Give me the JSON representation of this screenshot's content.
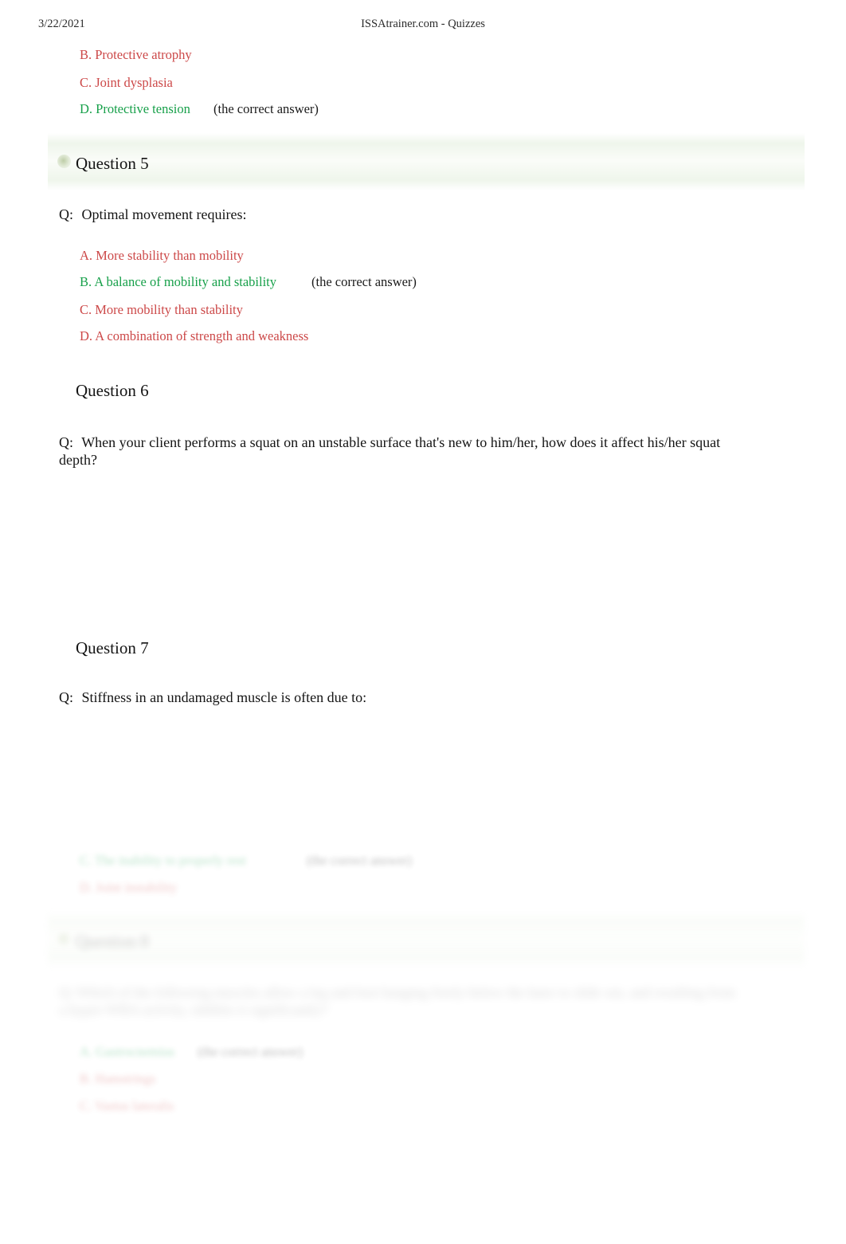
{
  "header": {
    "date": "3/22/2021",
    "title": "ISSAtrainer.com - Quizzes"
  },
  "colors": {
    "wrong_answer": "#cc4848",
    "correct_answer": "#17a04a",
    "banner_green": "#ecf4e8",
    "text": "#141414"
  },
  "labels": {
    "question_lead": "Q:",
    "correct_marker": "(the correct answer)"
  },
  "questions": [
    {
      "id": "q4-continued",
      "title": "",
      "banner": false,
      "stem": "",
      "visibility": "clear",
      "answers": [
        {
          "label": "B. Protective atrophy",
          "state": "wrong",
          "marker": ""
        },
        {
          "label": "C. Joint dysplasia",
          "state": "wrong",
          "marker": ""
        },
        {
          "label": "D. Protective tension",
          "state": "right",
          "marker": "(the correct answer)"
        }
      ]
    },
    {
      "id": "q5",
      "title": "Question 5",
      "banner": true,
      "stem": "Optimal movement requires:",
      "visibility": "clear",
      "answers": [
        {
          "label": "A. More stability than mobility",
          "state": "wrong",
          "marker": ""
        },
        {
          "label": "B. A balance of mobility and stability",
          "state": "right",
          "marker": "(the correct answer)"
        },
        {
          "label": "C. More mobility than stability",
          "state": "wrong",
          "marker": ""
        },
        {
          "label": "D. A combination of strength and weakness",
          "state": "wrong",
          "marker": ""
        }
      ]
    },
    {
      "id": "q6",
      "title": "Question 6",
      "banner": false,
      "stem": "When your client performs a squat on an unstable surface that's new to him/her, how does it affect his/her squat depth?",
      "visibility": "clear",
      "answers": []
    },
    {
      "id": "q7",
      "title": "Question 7",
      "banner": false,
      "stem": "Stiffness in an undamaged muscle is often due to:",
      "visibility": "partially-faded",
      "answers": [
        {
          "label": "C. The inability to properly rest",
          "state": "right",
          "marker": "(the correct answer)",
          "visibility": "faded"
        },
        {
          "label": "D. Joint instability",
          "state": "wrong",
          "marker": "",
          "visibility": "faded"
        }
      ]
    },
    {
      "id": "q8",
      "title": "Question 8",
      "banner": true,
      "stem": "Q:  Which of the following muscles allow a leg and foot hanging freely below the knee to slide out, and resulting from a hyper-WBA activity, inhibits it significantly?",
      "visibility": "faded",
      "answers": [
        {
          "label": "A. Gastrocnemius",
          "state": "right",
          "marker": "(the correct answer)",
          "visibility": "faded"
        },
        {
          "label": "B. Hamstrings",
          "state": "wrong",
          "marker": "",
          "visibility": "faded"
        },
        {
          "label": "C. Vastus lateralis",
          "state": "wrong",
          "marker": "",
          "visibility": "faded"
        }
      ]
    }
  ]
}
